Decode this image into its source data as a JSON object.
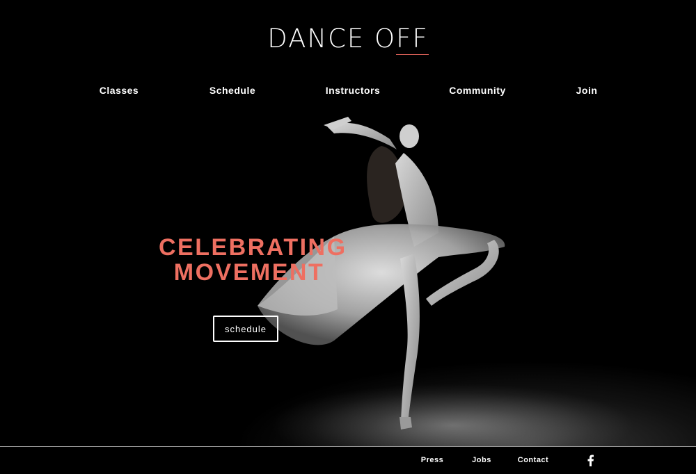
{
  "brand": {
    "logo_main": "DANCE O",
    "logo_accent": "FF"
  },
  "nav": {
    "items": [
      {
        "label": "Classes"
      },
      {
        "label": "Schedule"
      },
      {
        "label": "Instructors"
      },
      {
        "label": "Community"
      },
      {
        "label": "Join"
      }
    ]
  },
  "hero": {
    "headline_line1": "CELEBRATING",
    "headline_line2": "MOVEMENT",
    "cta_label": "schedule"
  },
  "footer": {
    "links": [
      {
        "label": "Press"
      },
      {
        "label": "Jobs"
      },
      {
        "label": "Contact"
      }
    ],
    "social_icon": "facebook-icon"
  },
  "colors": {
    "accent": "#ee6f61",
    "background": "#000000",
    "text": "#ffffff"
  }
}
